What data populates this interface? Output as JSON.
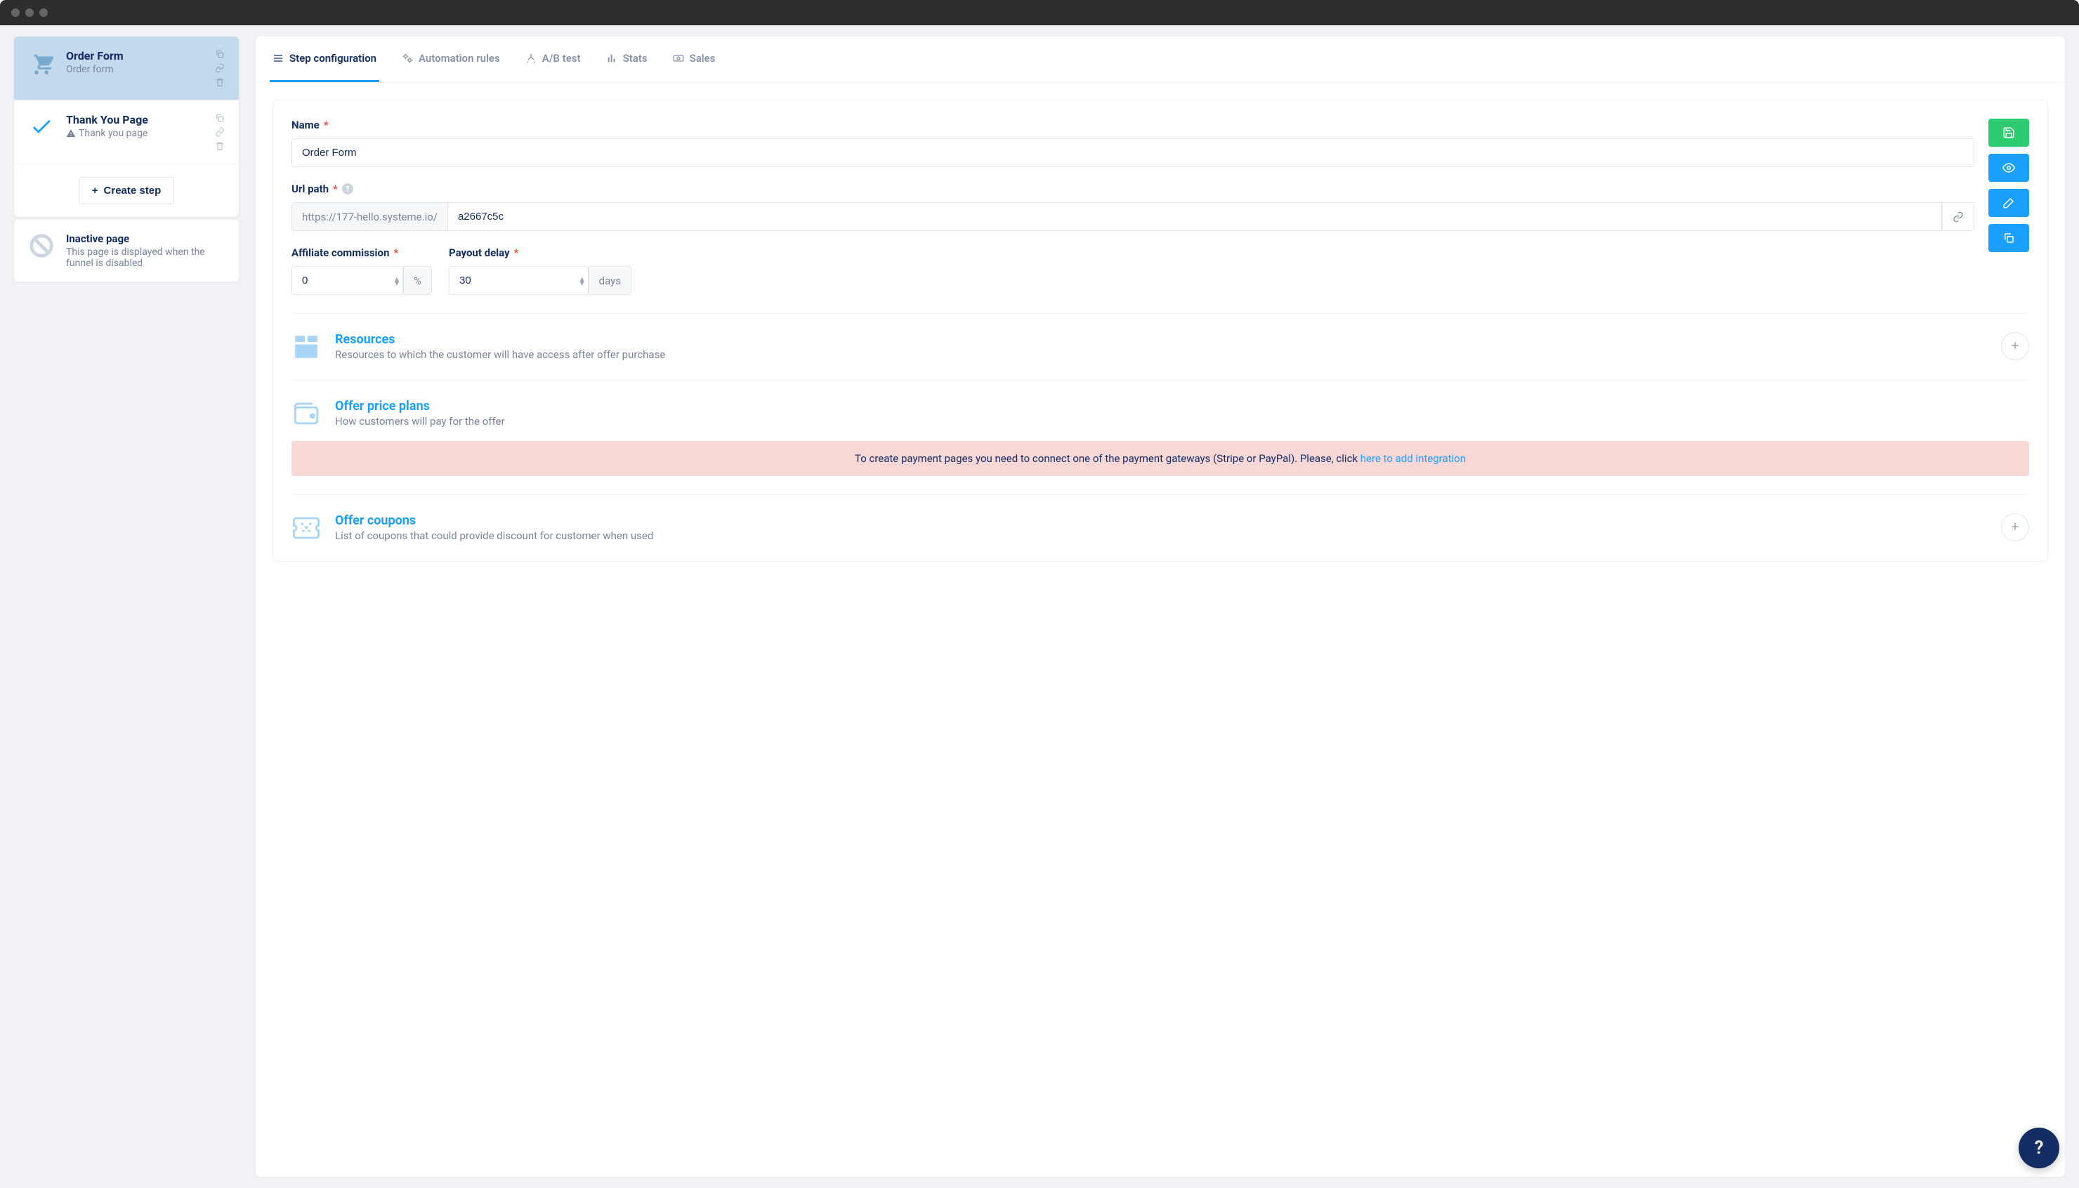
{
  "sidebar": {
    "steps": [
      {
        "title": "Order Form",
        "sub": "Order form",
        "warn": false
      },
      {
        "title": "Thank You Page",
        "sub": "Thank you page",
        "warn": true
      }
    ],
    "create_label": "Create step",
    "inactive": {
      "title": "Inactive page",
      "desc": "This page is displayed when the funnel is disabled"
    }
  },
  "tabs": [
    {
      "label": "Step configuration"
    },
    {
      "label": "Automation rules"
    },
    {
      "label": "A/B test"
    },
    {
      "label": "Stats"
    },
    {
      "label": "Sales"
    }
  ],
  "form": {
    "name_label": "Name",
    "name_value": "Order Form",
    "url_label": "Url path",
    "url_prefix": "https://177-hello.systeme.io/",
    "url_slug": "a2667c5c",
    "commission_label": "Affiliate commission",
    "commission_value": "0",
    "commission_unit": "%",
    "payout_label": "Payout delay",
    "payout_value": "30",
    "payout_unit": "days"
  },
  "sections": {
    "resources": {
      "title": "Resources",
      "desc": "Resources to which the customer will have access after offer purchase"
    },
    "plans": {
      "title": "Offer price plans",
      "desc": "How customers will pay for the offer"
    },
    "coupons": {
      "title": "Offer coupons",
      "desc": "List of coupons that could provide discount for customer when used"
    },
    "alert_text": "To create payment pages you need to connect one of the payment gateways (Stripe or PayPal). Please, click ",
    "alert_link": "here to add integration"
  },
  "help_glyph": "?"
}
